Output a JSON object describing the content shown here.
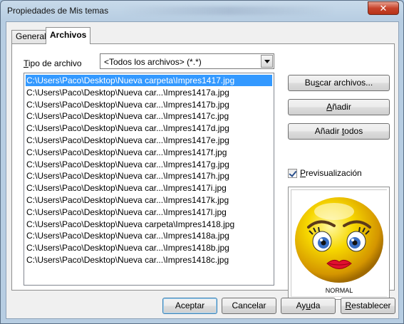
{
  "window": {
    "title": "Propiedades de Mis temas",
    "close_glyph": "✕"
  },
  "tabs": [
    {
      "label": "General",
      "active": false
    },
    {
      "label": "Archivos",
      "active": true
    }
  ],
  "file_type": {
    "label": "Tipo de archivo",
    "label_mnemonic_char": "T",
    "label_rest": "ipo de archivo",
    "selected": "<Todos los archivos> (*.*)"
  },
  "files": [
    "C:\\Users\\Paco\\Desktop\\Nueva carpeta\\Impres1417.jpg",
    "C:\\Users\\Paco\\Desktop\\Nueva car...\\Impres1417a.jpg",
    "C:\\Users\\Paco\\Desktop\\Nueva car...\\Impres1417b.jpg",
    "C:\\Users\\Paco\\Desktop\\Nueva car...\\Impres1417c.jpg",
    "C:\\Users\\Paco\\Desktop\\Nueva car...\\Impres1417d.jpg",
    "C:\\Users\\Paco\\Desktop\\Nueva car...\\Impres1417e.jpg",
    "C:\\Users\\Paco\\Desktop\\Nueva car...\\Impres1417f.jpg",
    "C:\\Users\\Paco\\Desktop\\Nueva car...\\Impres1417g.jpg",
    "C:\\Users\\Paco\\Desktop\\Nueva car...\\Impres1417h.jpg",
    "C:\\Users\\Paco\\Desktop\\Nueva car...\\Impres1417i.jpg",
    "C:\\Users\\Paco\\Desktop\\Nueva car...\\Impres1417k.jpg",
    "C:\\Users\\Paco\\Desktop\\Nueva car...\\Impres1417l.jpg",
    "C:\\Users\\Paco\\Desktop\\Nueva carpeta\\Impres1418.jpg",
    "C:\\Users\\Paco\\Desktop\\Nueva car...\\Impres1418a.jpg",
    "C:\\Users\\Paco\\Desktop\\Nueva car...\\Impres1418b.jpg",
    "C:\\Users\\Paco\\Desktop\\Nueva car...\\Impres1418c.jpg"
  ],
  "selected_file_index": 0,
  "buttons": {
    "buscar": "Buscar archivos...",
    "anadir": "Añadir",
    "anadir_todos": "Añadir todos"
  },
  "preview": {
    "checkbox_label": "Previsualización",
    "checked": true,
    "caption": "NORMAL"
  },
  "footer": {
    "aceptar": "Aceptar",
    "cancelar": "Cancelar",
    "ayuda": "Ayuda",
    "restablecer": "Restablecer"
  },
  "colors": {
    "selection": "#3399ff",
    "face": "#f5d000"
  }
}
